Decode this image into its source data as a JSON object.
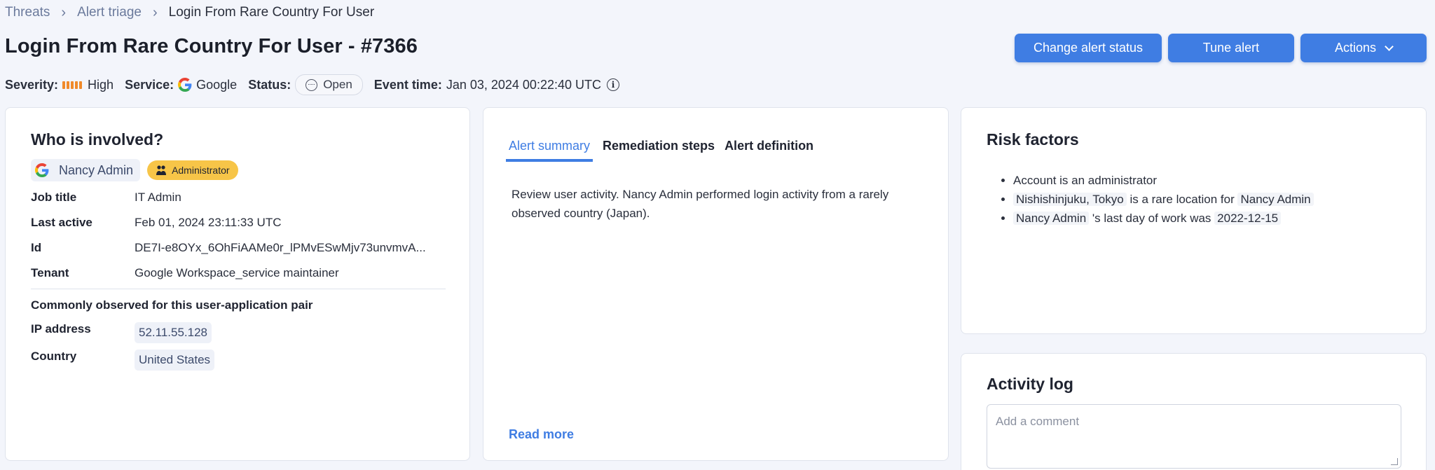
{
  "breadcrumb": {
    "items": [
      "Threats",
      "Alert triage",
      "Login From Rare Country For User"
    ]
  },
  "page": {
    "title": "Login From Rare Country For User - #7366"
  },
  "toolbar": {
    "change_status_label": "Change alert status",
    "tune_label": "Tune alert",
    "actions_label": "Actions"
  },
  "meta": {
    "severity_label": "Severity:",
    "severity_value": "High",
    "service_label": "Service:",
    "service_value": "Google",
    "status_label": "Status:",
    "status_value": "Open",
    "event_time_label": "Event time:",
    "event_time_value": "Jan 03, 2024 00:22:40 UTC"
  },
  "who": {
    "title": "Who is involved?",
    "user_name": "Nancy Admin",
    "role_badge": "Administrator",
    "fields": [
      {
        "key": "Job title",
        "value": "IT Admin"
      },
      {
        "key": "Last active",
        "value": "Feb 01, 2024 23:11:33 UTC"
      },
      {
        "key": "Id",
        "value": "DE7I-e8OYx_6OhFiAAMe0r_lPMvESwMjv73unvmvA..."
      },
      {
        "key": "Tenant",
        "value": "Google Workspace_service maintainer"
      }
    ],
    "common_title": "Commonly observed for this user-application pair",
    "ip_label": "IP address",
    "ip_value": "52.11.55.128",
    "country_label": "Country",
    "country_value": "United States"
  },
  "summary": {
    "tabs": [
      "Alert summary",
      "Remediation steps",
      "Alert definition"
    ],
    "active_tab": "Alert summary",
    "text": "Review user activity. Nancy Admin performed login activity from a rarely observed country (Japan).",
    "read_more": "Read more"
  },
  "risk": {
    "title": "Risk factors",
    "item1": "Account is an administrator",
    "item2_location": "Nishishinjuku, Tokyo",
    "item2_text": " is a rare location for ",
    "item2_user": "Nancy Admin",
    "item3_user": "Nancy Admin",
    "item3_text": " 's last day of work was ",
    "item3_date": "2022-12-15"
  },
  "activity": {
    "title": "Activity log",
    "comment_placeholder": "Add a comment"
  },
  "colors": {
    "accent": "#3f7de3",
    "severity_high": "#f08a2a",
    "admin_badge": "#f7c548"
  }
}
